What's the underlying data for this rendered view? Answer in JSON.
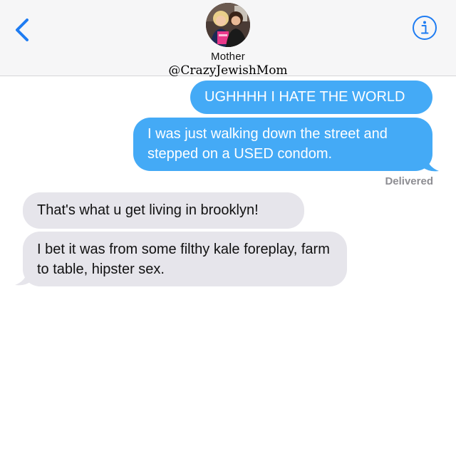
{
  "header": {
    "contact_name": "Mother",
    "handle": "@CrazyJewishMom",
    "back_icon": "chevron-left-icon",
    "info_icon": "info-icon"
  },
  "messages": [
    {
      "direction": "sent",
      "text": "UGHHHH I HATE THE WORLD"
    },
    {
      "direction": "sent",
      "text": "I was just walking down the street and stepped on a USED condom."
    },
    {
      "direction": "received",
      "text": "That's what u get living in brooklyn!"
    },
    {
      "direction": "received",
      "text": "I bet it was from some filthy kale foreplay, farm to table, hipster sex."
    }
  ],
  "status": {
    "delivered_label": "Delivered"
  },
  "colors": {
    "sent_bubble": "#44aaf6",
    "received_bubble": "#e6e5eb",
    "accent": "#1e7cf2"
  }
}
